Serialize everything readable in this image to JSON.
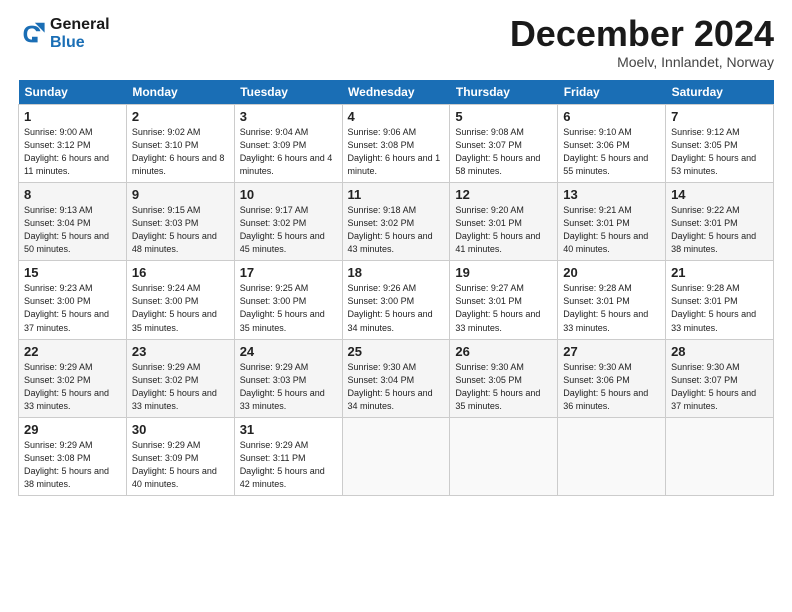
{
  "logo": {
    "line1": "General",
    "line2": "Blue"
  },
  "title": "December 2024",
  "subtitle": "Moelv, Innlandet, Norway",
  "weekdays": [
    "Sunday",
    "Monday",
    "Tuesday",
    "Wednesday",
    "Thursday",
    "Friday",
    "Saturday"
  ],
  "weeks": [
    [
      {
        "day": "1",
        "sunrise": "Sunrise: 9:00 AM",
        "sunset": "Sunset: 3:12 PM",
        "daylight": "Daylight: 6 hours and 11 minutes."
      },
      {
        "day": "2",
        "sunrise": "Sunrise: 9:02 AM",
        "sunset": "Sunset: 3:10 PM",
        "daylight": "Daylight: 6 hours and 8 minutes."
      },
      {
        "day": "3",
        "sunrise": "Sunrise: 9:04 AM",
        "sunset": "Sunset: 3:09 PM",
        "daylight": "Daylight: 6 hours and 4 minutes."
      },
      {
        "day": "4",
        "sunrise": "Sunrise: 9:06 AM",
        "sunset": "Sunset: 3:08 PM",
        "daylight": "Daylight: 6 hours and 1 minute."
      },
      {
        "day": "5",
        "sunrise": "Sunrise: 9:08 AM",
        "sunset": "Sunset: 3:07 PM",
        "daylight": "Daylight: 5 hours and 58 minutes."
      },
      {
        "day": "6",
        "sunrise": "Sunrise: 9:10 AM",
        "sunset": "Sunset: 3:06 PM",
        "daylight": "Daylight: 5 hours and 55 minutes."
      },
      {
        "day": "7",
        "sunrise": "Sunrise: 9:12 AM",
        "sunset": "Sunset: 3:05 PM",
        "daylight": "Daylight: 5 hours and 53 minutes."
      }
    ],
    [
      {
        "day": "8",
        "sunrise": "Sunrise: 9:13 AM",
        "sunset": "Sunset: 3:04 PM",
        "daylight": "Daylight: 5 hours and 50 minutes."
      },
      {
        "day": "9",
        "sunrise": "Sunrise: 9:15 AM",
        "sunset": "Sunset: 3:03 PM",
        "daylight": "Daylight: 5 hours and 48 minutes."
      },
      {
        "day": "10",
        "sunrise": "Sunrise: 9:17 AM",
        "sunset": "Sunset: 3:02 PM",
        "daylight": "Daylight: 5 hours and 45 minutes."
      },
      {
        "day": "11",
        "sunrise": "Sunrise: 9:18 AM",
        "sunset": "Sunset: 3:02 PM",
        "daylight": "Daylight: 5 hours and 43 minutes."
      },
      {
        "day": "12",
        "sunrise": "Sunrise: 9:20 AM",
        "sunset": "Sunset: 3:01 PM",
        "daylight": "Daylight: 5 hours and 41 minutes."
      },
      {
        "day": "13",
        "sunrise": "Sunrise: 9:21 AM",
        "sunset": "Sunset: 3:01 PM",
        "daylight": "Daylight: 5 hours and 40 minutes."
      },
      {
        "day": "14",
        "sunrise": "Sunrise: 9:22 AM",
        "sunset": "Sunset: 3:01 PM",
        "daylight": "Daylight: 5 hours and 38 minutes."
      }
    ],
    [
      {
        "day": "15",
        "sunrise": "Sunrise: 9:23 AM",
        "sunset": "Sunset: 3:00 PM",
        "daylight": "Daylight: 5 hours and 37 minutes."
      },
      {
        "day": "16",
        "sunrise": "Sunrise: 9:24 AM",
        "sunset": "Sunset: 3:00 PM",
        "daylight": "Daylight: 5 hours and 35 minutes."
      },
      {
        "day": "17",
        "sunrise": "Sunrise: 9:25 AM",
        "sunset": "Sunset: 3:00 PM",
        "daylight": "Daylight: 5 hours and 35 minutes."
      },
      {
        "day": "18",
        "sunrise": "Sunrise: 9:26 AM",
        "sunset": "Sunset: 3:00 PM",
        "daylight": "Daylight: 5 hours and 34 minutes."
      },
      {
        "day": "19",
        "sunrise": "Sunrise: 9:27 AM",
        "sunset": "Sunset: 3:01 PM",
        "daylight": "Daylight: 5 hours and 33 minutes."
      },
      {
        "day": "20",
        "sunrise": "Sunrise: 9:28 AM",
        "sunset": "Sunset: 3:01 PM",
        "daylight": "Daylight: 5 hours and 33 minutes."
      },
      {
        "day": "21",
        "sunrise": "Sunrise: 9:28 AM",
        "sunset": "Sunset: 3:01 PM",
        "daylight": "Daylight: 5 hours and 33 minutes."
      }
    ],
    [
      {
        "day": "22",
        "sunrise": "Sunrise: 9:29 AM",
        "sunset": "Sunset: 3:02 PM",
        "daylight": "Daylight: 5 hours and 33 minutes."
      },
      {
        "day": "23",
        "sunrise": "Sunrise: 9:29 AM",
        "sunset": "Sunset: 3:02 PM",
        "daylight": "Daylight: 5 hours and 33 minutes."
      },
      {
        "day": "24",
        "sunrise": "Sunrise: 9:29 AM",
        "sunset": "Sunset: 3:03 PM",
        "daylight": "Daylight: 5 hours and 33 minutes."
      },
      {
        "day": "25",
        "sunrise": "Sunrise: 9:30 AM",
        "sunset": "Sunset: 3:04 PM",
        "daylight": "Daylight: 5 hours and 34 minutes."
      },
      {
        "day": "26",
        "sunrise": "Sunrise: 9:30 AM",
        "sunset": "Sunset: 3:05 PM",
        "daylight": "Daylight: 5 hours and 35 minutes."
      },
      {
        "day": "27",
        "sunrise": "Sunrise: 9:30 AM",
        "sunset": "Sunset: 3:06 PM",
        "daylight": "Daylight: 5 hours and 36 minutes."
      },
      {
        "day": "28",
        "sunrise": "Sunrise: 9:30 AM",
        "sunset": "Sunset: 3:07 PM",
        "daylight": "Daylight: 5 hours and 37 minutes."
      }
    ],
    [
      {
        "day": "29",
        "sunrise": "Sunrise: 9:29 AM",
        "sunset": "Sunset: 3:08 PM",
        "daylight": "Daylight: 5 hours and 38 minutes."
      },
      {
        "day": "30",
        "sunrise": "Sunrise: 9:29 AM",
        "sunset": "Sunset: 3:09 PM",
        "daylight": "Daylight: 5 hours and 40 minutes."
      },
      {
        "day": "31",
        "sunrise": "Sunrise: 9:29 AM",
        "sunset": "Sunset: 3:11 PM",
        "daylight": "Daylight: 5 hours and 42 minutes."
      },
      null,
      null,
      null,
      null
    ]
  ]
}
